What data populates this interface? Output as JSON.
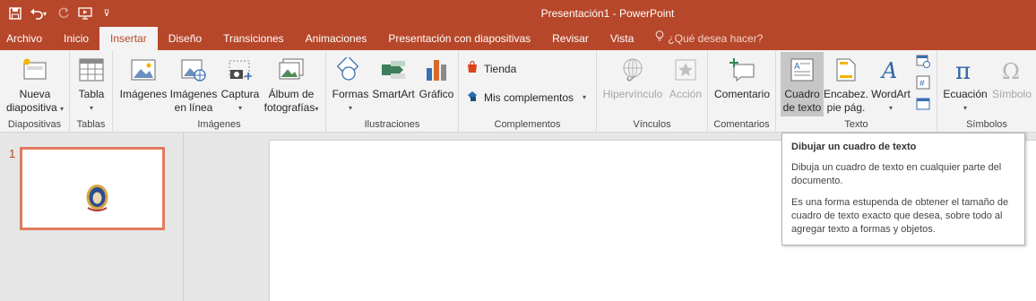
{
  "window": {
    "title": "Presentación1 - PowerPoint"
  },
  "qat": {
    "save_icon": "save-icon",
    "undo_icon": "undo-icon",
    "redo_icon": "redo-icon",
    "present_icon": "start-from-beginning-icon"
  },
  "tabs": [
    "Archivo",
    "Inicio",
    "Insertar",
    "Diseño",
    "Transiciones",
    "Animaciones",
    "Presentación con diapositivas",
    "Revisar",
    "Vista"
  ],
  "active_tab": "Insertar",
  "tell_me": "¿Qué desea hacer?",
  "ribbon": {
    "groups": {
      "diapositivas": "Diapositivas",
      "tablas": "Tablas",
      "imagenes": "Imágenes",
      "ilustraciones": "Ilustraciones",
      "complementos": "Complementos",
      "vinculos": "Vínculos",
      "comentarios": "Comentarios",
      "texto": "Texto",
      "simbolos": "Símbolos"
    },
    "buttons": {
      "nueva_l1": "Nueva",
      "nueva_l2": "diapositiva",
      "tabla": "Tabla",
      "imagenes": "Imágenes",
      "imagenes_linea_l1": "Imágenes",
      "imagenes_linea_l2": "en línea",
      "captura": "Captura",
      "album_l1": "Álbum de",
      "album_l2": "fotografías",
      "formas": "Formas",
      "smartart": "SmartArt",
      "grafico": "Gráfico",
      "tienda": "Tienda",
      "mis_complementos": "Mis complementos",
      "hipervinculo": "Hipervínculo",
      "accion": "Acción",
      "comentario": "Comentario",
      "cuadro_l1": "Cuadro",
      "cuadro_l2": "de texto",
      "encabez_l1": "Encabez.",
      "encabez_l2": "pie pág.",
      "wordart": "WordArt",
      "ecuacion": "Ecuación",
      "simbolo": "Símbolo"
    }
  },
  "slides": {
    "selected_number": "1"
  },
  "tooltip": {
    "title": "Dibujar un cuadro de texto",
    "p1": "Dibuja un cuadro de texto en cualquier parte del documento.",
    "p2": "Es una forma estupenda de obtener el tamaño de cuadro de texto exacto que desea, sobre todo al agregar texto a formas y objetos."
  },
  "colors": {
    "accent": "#b7472a",
    "ribbon_bg": "#f3f3f3",
    "selected_thumb_border": "#e07b5f"
  }
}
